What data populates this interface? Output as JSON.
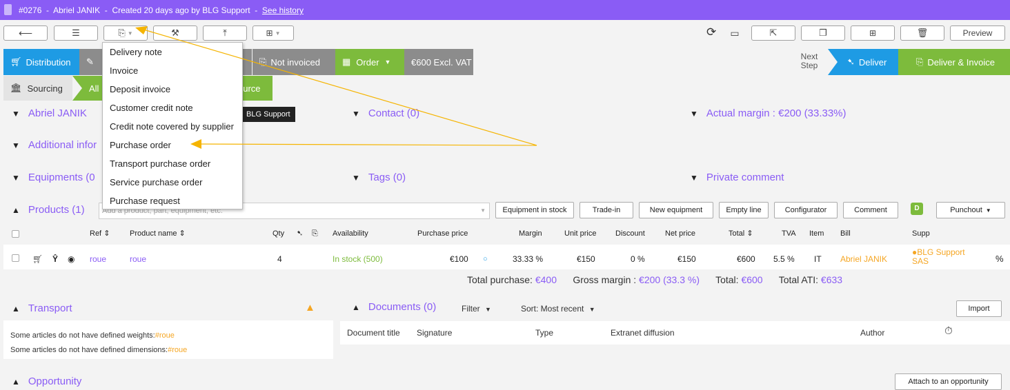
{
  "header": {
    "number": "#0276",
    "sep1": "-",
    "customer": "Abriel JANIK",
    "sep2": "-",
    "created": "Created 20 days ago by BLG Support",
    "sep3": "-",
    "history_link": "See history"
  },
  "toolbar": {
    "preview_label": "Preview"
  },
  "status": {
    "distribution": "Distribution",
    "not_invoiced": "Not invoiced",
    "order": "Order",
    "amount": "€600 Excl. VAT",
    "next_step_1": "Next",
    "next_step_2": "Step",
    "deliver": "Deliver",
    "deliver_invoice": "Deliver & Invoice"
  },
  "sourcing": {
    "label": "Sourcing",
    "all_prefix": "All",
    "source_suffix": "ource"
  },
  "dropdown": {
    "items": [
      "Delivery note",
      "Invoice",
      "Deposit invoice",
      "Customer credit note",
      "Credit note covered by supplier",
      "Purchase order",
      "Transport purchase order",
      "Service purchase order",
      "Purchase request"
    ]
  },
  "sections": {
    "customer": "Abriel JANIK",
    "owner_badge": "BLG Support",
    "contact": "Contact (0)",
    "margin": "Actual margin : €200 (33.33%)",
    "additional": "Additional infor",
    "equipments": "Equipments (0",
    "tags": "Tags (0)",
    "private_comment": "Private comment"
  },
  "products": {
    "title": "Products (1)",
    "search_placeholder": "Add a product, part, equipment, etc.",
    "buttons": [
      "Equipment in stock",
      "Trade-in",
      "New equipment",
      "Empty line",
      "Configurator",
      "Comment"
    ],
    "d_badge": "D",
    "punchout": "Punchout",
    "columns": {
      "ref": "Ref",
      "name": "Product name",
      "qty": "Qty",
      "availability": "Availability",
      "purchase_price": "Purchase price",
      "margin": "Margin",
      "unit_price": "Unit price",
      "discount": "Discount",
      "net_price": "Net price",
      "total": "Total",
      "tva": "TVA",
      "item": "Item",
      "bill": "Bill",
      "supp": "Supp"
    },
    "rows": [
      {
        "ref": "roue",
        "name": "roue",
        "qty": "4",
        "availability": "In stock (500)",
        "purchase_price": "€100",
        "margin": "33.33 %",
        "unit_price": "€150",
        "discount": "0 %",
        "net_price": "€150",
        "total": "€600",
        "tva": "5.5 %",
        "item": "IT",
        "bill": "Abriel JANIK",
        "supp_1": "●BLG Support",
        "supp_2": "SAS",
        "pct": "%"
      }
    ],
    "totals": {
      "purchase_label": "Total purchase:",
      "purchase_value": "€400",
      "gross_label": "Gross margin :",
      "gross_value": "€200 (33.3 %)",
      "total_label": "Total:",
      "total_value": "€600",
      "ati_label": "Total ATI:",
      "ati_value": "€633"
    }
  },
  "transport": {
    "title": "Transport",
    "line1_text": "Some articles do not have defined weights:",
    "line1_link": "#roue",
    "line2_text": "Some articles do not have defined dimensions:",
    "line2_link": "#roue"
  },
  "documents": {
    "title": "Documents (0)",
    "filter": "Filter",
    "sort": "Sort: Most recent",
    "import": "Import",
    "columns": [
      "Document title",
      "Signature",
      "Type",
      "Extranet diffusion",
      "Author"
    ]
  },
  "opportunity": {
    "title": "Opportunity",
    "attach": "Attach to an opportunity"
  },
  "colors": {
    "purple": "#8a5cf5",
    "blue": "#1e9be4",
    "grey": "#8c8c8c",
    "green": "#7dbb3c",
    "orange": "#f5a623"
  }
}
